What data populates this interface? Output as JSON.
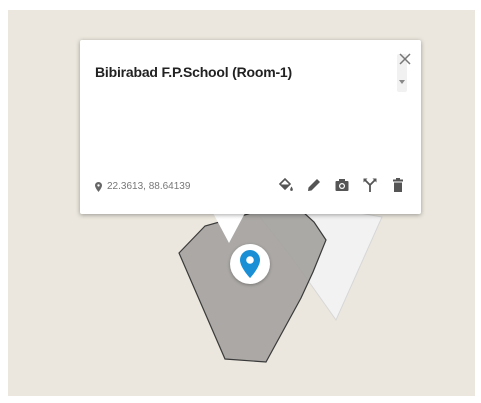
{
  "popup": {
    "title": "Bibirabad F.P.School (Room-1)",
    "coordinates": "22.3613, 88.64139"
  },
  "icons": {
    "close": "close-icon",
    "scroll": "chevron-down-icon",
    "location": "location-pin-icon",
    "fill": "paint-bucket-icon",
    "edit": "pencil-icon",
    "photo": "camera-icon",
    "route": "directions-fork-icon",
    "delete": "trash-icon",
    "marker": "map-marker-icon"
  },
  "colors": {
    "map_background": "#ebe7de",
    "polygon_fill": "#a5a39f",
    "secondary_polygon_fill": "#f2f2f2",
    "marker_blue": "#1a8fd6",
    "icon_gray": "#555555"
  }
}
